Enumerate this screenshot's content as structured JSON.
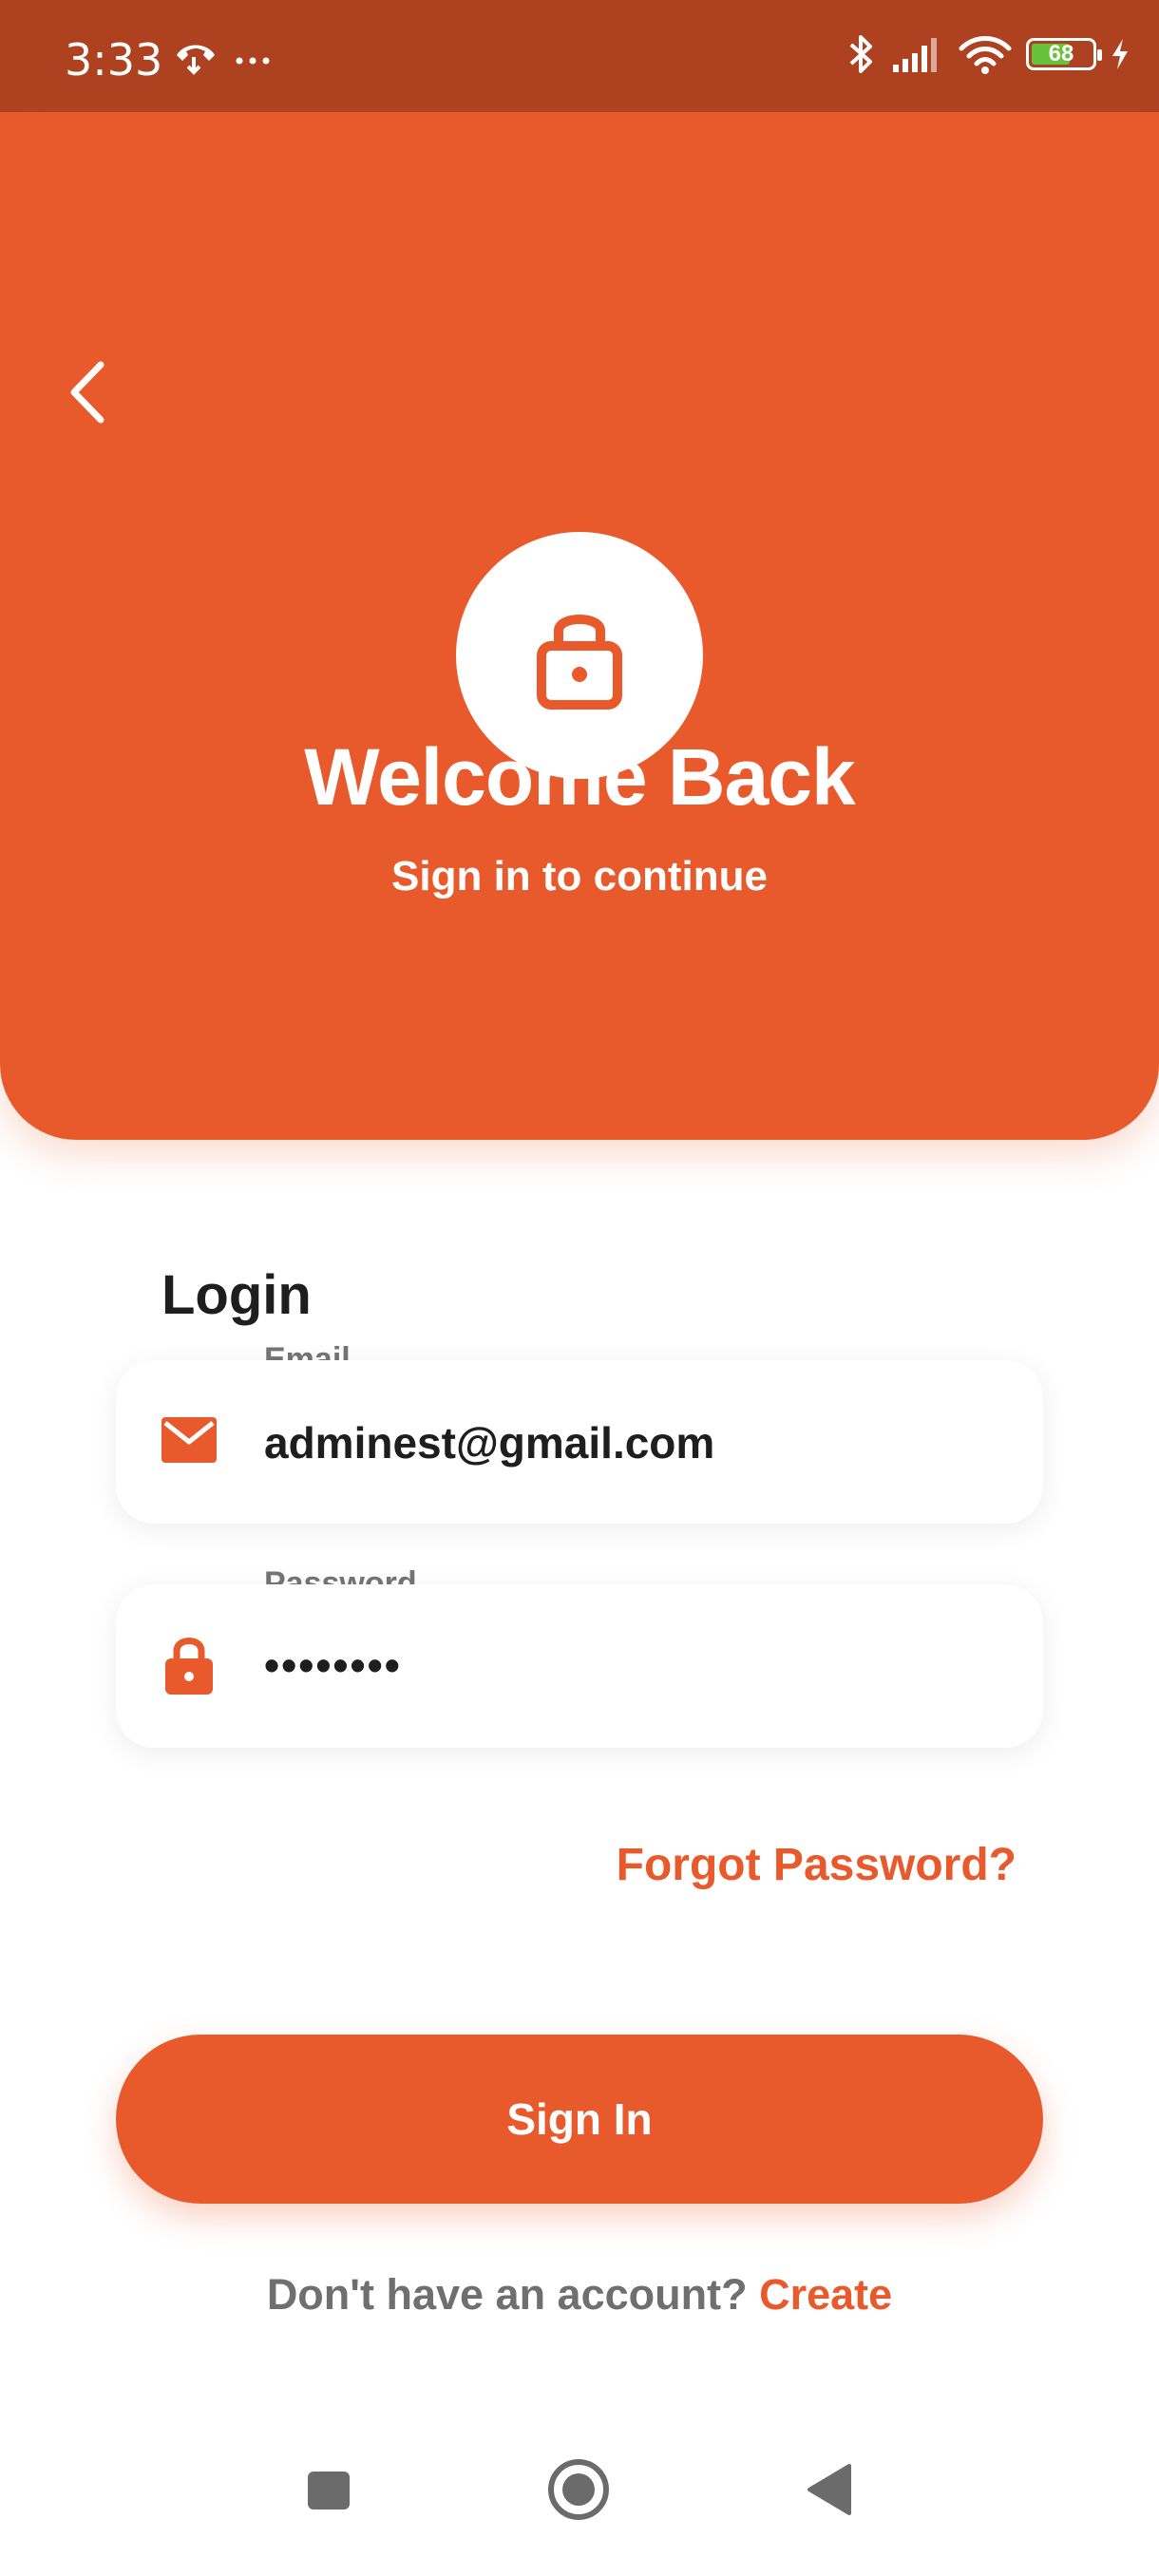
{
  "status_bar": {
    "time": "3:33",
    "battery_level": 68,
    "battery_text": "68",
    "icons": [
      "call-icon",
      "more-dots-icon",
      "bluetooth-icon",
      "signal-icon",
      "wifi-icon",
      "battery-icon",
      "charging-icon"
    ]
  },
  "header": {
    "title": "Welcome Back",
    "subtitle": "Sign in to continue"
  },
  "form": {
    "title": "Login",
    "email_label": "Email",
    "email_value": "adminest@gmail.com",
    "password_label": "Password",
    "password_value": "••••••••"
  },
  "links": {
    "forgot": "Forgot Password?",
    "no_account": "Don't have an account?",
    "create": "Create"
  },
  "buttons": {
    "sign_in": "Sign In"
  },
  "colors": {
    "accent": "#E85A2C",
    "status_bar": "#AE4220",
    "battery_fill": "#67C23A"
  }
}
